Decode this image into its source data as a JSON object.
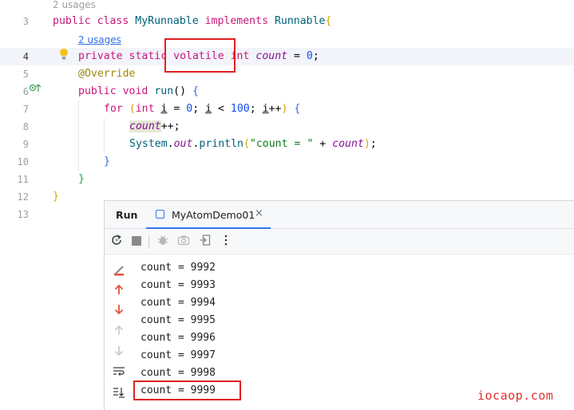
{
  "editor": {
    "line_numbers": [
      "3",
      "4",
      "5",
      "6",
      "7",
      "8",
      "9",
      "10",
      "11",
      "12",
      "13"
    ],
    "hint_top": "2 usages",
    "hint_field": "2 usages",
    "lines": {
      "l3": {
        "kw1": "public",
        "kw2": "class",
        "cls": "MyRunnable",
        "kw3": "implements",
        "iface": "Runnable",
        "brace": "{"
      },
      "l4": {
        "kw1": "private",
        "kw2": "static",
        "kw3": "volatile",
        "kw4": "int",
        "field": "count",
        "rest": " = ",
        "num": "0",
        "end": ";"
      },
      "l5": {
        "ann": "@Override"
      },
      "l6": {
        "kw1": "public",
        "kw2": "void",
        "fn": "run",
        "paren": "()",
        "brace": "{"
      },
      "l7": {
        "kw": "for",
        "p1": "(",
        "kw2": "int",
        "var": "i",
        "a": " = ",
        "n1": "0",
        "b": "; ",
        "var2": "i",
        "c": " < ",
        "n2": "100",
        "d": "; ",
        "var3": "i",
        "e": "++",
        "p2": ")",
        "brace": "{"
      },
      "l8": {
        "field": "count",
        "rest": "++;"
      },
      "l9": {
        "cls": "System",
        "dot": ".",
        "out": "out",
        "dot2": ".",
        "fn": "println",
        "p1": "(",
        "str": "\"count = \"",
        "plus": " + ",
        "field": "count",
        "p2": ")",
        "end": ";"
      },
      "l10": {
        "brace": "}"
      },
      "l11": {
        "brace": "}"
      },
      "l12": {
        "brace": "}"
      }
    }
  },
  "run_panel": {
    "title": "Run",
    "tab_label": "MyAtomDemo01",
    "tab_close": "×",
    "toolbar_icons": [
      "rerun-icon",
      "stop-icon",
      "debug-icon",
      "camera-icon",
      "exit-icon",
      "more-icon"
    ],
    "side_icons": [
      "clear-icon",
      "up-arrow-icon",
      "down-arrow-icon",
      "up-gray-icon",
      "down-gray-icon",
      "soft-wrap-icon",
      "scroll-end-icon"
    ],
    "output": [
      "count = 9992",
      "count = 9993",
      "count = 9994",
      "count = 9995",
      "count = 9996",
      "count = 9997",
      "count = 9998",
      "count = 9999"
    ]
  },
  "watermark": "iocaop.com",
  "colors": {
    "highlight_box": "#e02020",
    "accent": "#3574f0"
  }
}
